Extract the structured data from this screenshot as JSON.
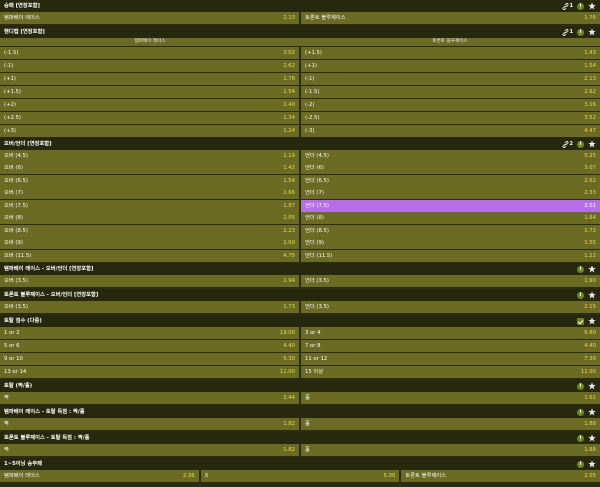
{
  "sections": [
    {
      "title": "승패 [연장포함]",
      "icons": {
        "link": "1",
        "circle": "i",
        "star": true
      }
    },
    {
      "title": "핸디캡 [연장포함]",
      "icons": {
        "link": "1",
        "circle": "i",
        "star": true
      }
    },
    {
      "title": "오버/언더 [연장포함]",
      "icons": {
        "link": "2",
        "circle": "i",
        "star": true
      }
    },
    {
      "title": "탬파베이 레이스 - 오버/언더 [연장포함]",
      "icons": {
        "circle": "i",
        "star": true
      }
    },
    {
      "title": "토론토 블루제이스 - 오버/언더 [연장포함]",
      "icons": {
        "circle": "i",
        "star": true
      }
    },
    {
      "title": "토탈 점수 (다중)",
      "icons": {
        "check": true,
        "star": true
      }
    },
    {
      "title": "토탈 (짝/홀)",
      "icons": {
        "circle": "i",
        "star": true
      }
    },
    {
      "title": "탬파베이 레이스 - 토탈 득점 : 짝/홀",
      "icons": {
        "circle": "i",
        "star": true
      }
    },
    {
      "title": "토론토 블루제이스 - 토탈 득점 : 짝/홀",
      "icons": {
        "circle": "i",
        "star": true
      }
    },
    {
      "title": "1~5이닝 승무패",
      "icons": {
        "circle": "i",
        "star": true
      }
    }
  ],
  "moneyline": [
    [
      {
        "label": "탬파베이 레이스",
        "odd": "2.13"
      },
      {
        "label": "토론토 블루제이스",
        "odd": "1.76"
      }
    ]
  ],
  "handicap_headers": [
    "탬파베이 레이스",
    "토론토 블루제이스"
  ],
  "handicap": [
    [
      {
        "label": "(-1.5)",
        "odd": "3.02"
      },
      {
        "label": "(+1.5)",
        "odd": "1.43"
      }
    ],
    [
      {
        "label": "(-1)",
        "odd": "2.62"
      },
      {
        "label": "(+1)",
        "odd": "1.54"
      }
    ],
    [
      {
        "label": "(+1)",
        "odd": "1.78"
      },
      {
        "label": "(-1)",
        "odd": "2.13"
      }
    ],
    [
      {
        "label": "(+1.5)",
        "odd": "1.54"
      },
      {
        "label": "(-1.5)",
        "odd": "2.62"
      }
    ],
    [
      {
        "label": "(+2)",
        "odd": "1.40"
      },
      {
        "label": "(-2)",
        "odd": "3.16"
      }
    ],
    [
      {
        "label": "(+2.5)",
        "odd": "1.34"
      },
      {
        "label": "(-2.5)",
        "odd": "3.52"
      }
    ],
    [
      {
        "label": "(+3)",
        "odd": "1.24"
      },
      {
        "label": "(-3)",
        "odd": "4.47"
      }
    ]
  ],
  "over_under": [
    [
      {
        "label": "오버 (4.5)",
        "odd": "1.19"
      },
      {
        "label": "언더 (4.5)",
        "odd": "5.25"
      }
    ],
    [
      {
        "label": "오버 (6)",
        "odd": "1.42"
      },
      {
        "label": "언더 (6)",
        "odd": "3.07"
      }
    ],
    [
      {
        "label": "오버 (6.5)",
        "odd": "1.54"
      },
      {
        "label": "언더 (6.5)",
        "odd": "2.62"
      }
    ],
    [
      {
        "label": "오버 (7)",
        "odd": "1.66"
      },
      {
        "label": "언더 (7)",
        "odd": "2.33"
      }
    ],
    [
      {
        "label": "오버 (7.5)",
        "odd": "1.87"
      },
      {
        "label": "언더 (7.5)",
        "odd": "2.01",
        "selected": true
      }
    ],
    [
      {
        "label": "오버 (8)",
        "odd": "2.05"
      },
      {
        "label": "언더 (8)",
        "odd": "1.84"
      }
    ],
    [
      {
        "label": "오버 (8.5)",
        "odd": "2.23"
      },
      {
        "label": "언더 (8.5)",
        "odd": "1.72"
      }
    ],
    [
      {
        "label": "오버 (9)",
        "odd": "2.60"
      },
      {
        "label": "언더 (9)",
        "odd": "1.55"
      }
    ],
    [
      {
        "label": "오버 (11.5)",
        "odd": "4.75"
      },
      {
        "label": "언더 (11.5)",
        "odd": "1.22"
      }
    ]
  ],
  "tb_ou": [
    [
      {
        "label": "오버 (3.5)",
        "odd": "1.94"
      },
      {
        "label": "언더 (3.5)",
        "odd": "1.90"
      }
    ]
  ],
  "tor_ou": [
    [
      {
        "label": "오버 (3.5)",
        "odd": "1.73"
      },
      {
        "label": "언더 (3.5)",
        "odd": "2.15"
      }
    ]
  ],
  "total_multi": [
    [
      {
        "label": "1 or 2",
        "odd": "19.00"
      },
      {
        "label": "3 or 4",
        "odd": "6.80"
      }
    ],
    [
      {
        "label": "5 or 6",
        "odd": "4.40"
      },
      {
        "label": "7 or 8",
        "odd": "4.40"
      }
    ],
    [
      {
        "label": "9 or 10",
        "odd": "5.30"
      },
      {
        "label": "11 or 12",
        "odd": "7.30"
      }
    ],
    [
      {
        "label": "13 or 14",
        "odd": "11.00"
      },
      {
        "label": "15 이상",
        "odd": "11.00"
      }
    ]
  ],
  "total_oe": [
    [
      {
        "label": "짝",
        "odd": "2.44"
      },
      {
        "label": "홀",
        "odd": "1.61"
      }
    ]
  ],
  "tb_oe": [
    [
      {
        "label": "짝",
        "odd": "1.82"
      },
      {
        "label": "홀",
        "odd": "1.88"
      }
    ]
  ],
  "tor_oe": [
    [
      {
        "label": "짝",
        "odd": "1.82"
      },
      {
        "label": "홀",
        "odd": "1.88"
      }
    ]
  ],
  "inning15": [
    [
      {
        "label": "탬파베이 레이스",
        "odd": "2.36"
      },
      {
        "label": "X",
        "odd": "5.00"
      },
      {
        "label": "토론토 블루제이스",
        "odd": "2.05"
      }
    ]
  ]
}
